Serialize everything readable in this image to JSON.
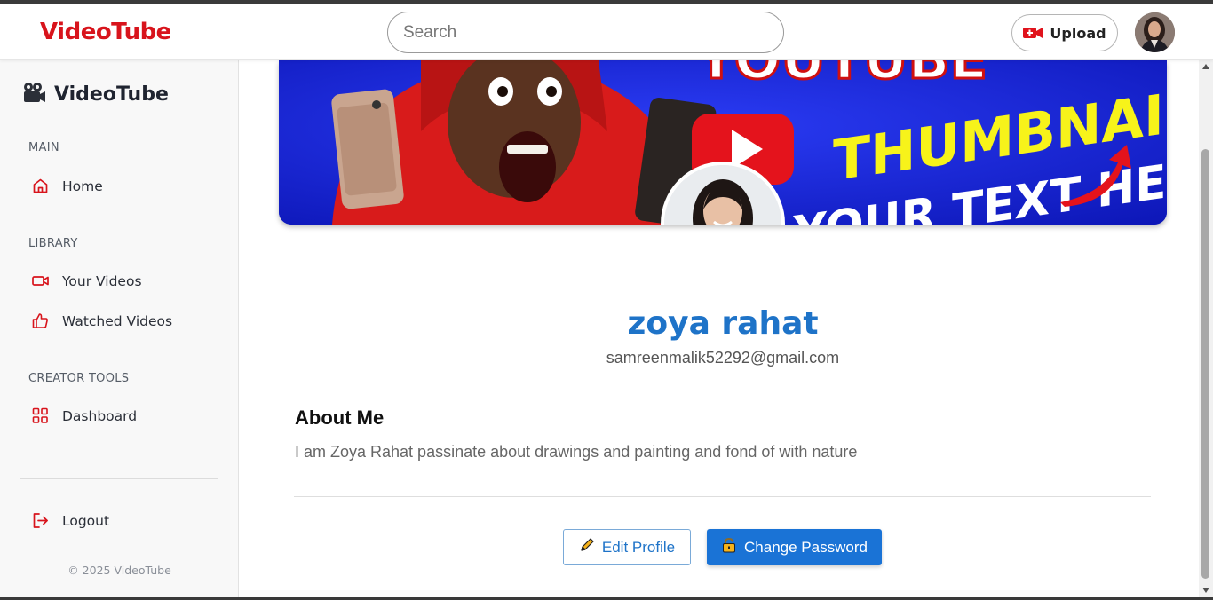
{
  "app": {
    "brand": "VideoTube"
  },
  "header": {
    "search_placeholder": "Search",
    "upload_label": "Upload",
    "upload_icon": "video-camera-plus-icon",
    "avatar_icon": "user-avatar"
  },
  "sidebar": {
    "brand": "VideoTube",
    "brand_icon": "film-camera-icon",
    "sections": [
      {
        "label": "MAIN",
        "items": [
          {
            "label": "Home",
            "icon": "home-icon"
          }
        ]
      },
      {
        "label": "LIBRARY",
        "items": [
          {
            "label": "Your Videos",
            "icon": "video-icon"
          },
          {
            "label": "Watched Videos",
            "icon": "thumbs-up-icon"
          }
        ]
      },
      {
        "label": "CREATOR TOOLS",
        "items": [
          {
            "label": "Dashboard",
            "icon": "grid-icon"
          }
        ]
      }
    ],
    "logout_label": "Logout",
    "copyright": "© 2025 VideoTube"
  },
  "banner": {
    "line1": "THUMBNAIL",
    "line2": "YOUR TEXT HERE",
    "top_text": "YOUTUBE"
  },
  "profile": {
    "name": "zoya rahat",
    "email": "samreenmalik52292@gmail.com",
    "about_title": "About Me",
    "about_text": "I am Zoya Rahat passinate about drawings and painting and fond of with nature",
    "edit_label": "Edit Profile",
    "change_password_label": "Change Password"
  },
  "colors": {
    "brand_red": "#d8141c",
    "accent_blue": "#1e73c8",
    "button_blue": "#1a73d6"
  }
}
